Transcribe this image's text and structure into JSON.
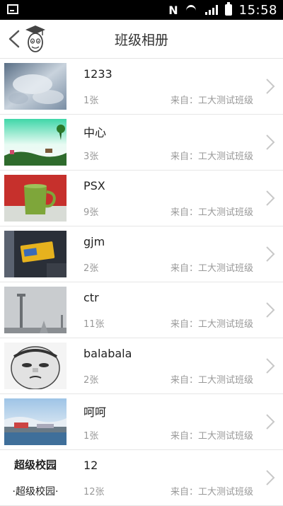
{
  "status_bar": {
    "time": "15:58",
    "nfc": "N"
  },
  "header": {
    "title": "班级相册"
  },
  "albums": [
    {
      "name": "1233",
      "count": "1张",
      "source": "来自：工大测试班级",
      "thumb": "sky-clouds"
    },
    {
      "name": "中心",
      "count": "3张",
      "source": "来自：工大测试班级",
      "thumb": "green-garden"
    },
    {
      "name": "PSX",
      "count": "9张",
      "source": "来自：工大测试班级",
      "thumb": "green-mug"
    },
    {
      "name": "gjm",
      "count": "2张",
      "source": "来自：工大测试班级",
      "thumb": "yellow-sign"
    },
    {
      "name": "ctr",
      "count": "11张",
      "source": "来自：工大测试班级",
      "thumb": "grey-tower"
    },
    {
      "name": "balabala",
      "count": "2张",
      "source": "来自：工大测试班级",
      "thumb": "meme-face"
    },
    {
      "name": "呵呵",
      "count": "1张",
      "source": "来自：工大测试班级",
      "thumb": "harbor"
    },
    {
      "name": "12",
      "count": "12张",
      "source": "来自：工大测试班级",
      "thumb": "logo-text",
      "thumb_text_top": "超级校园",
      "thumb_text_bottom": "·超级校园·"
    }
  ]
}
